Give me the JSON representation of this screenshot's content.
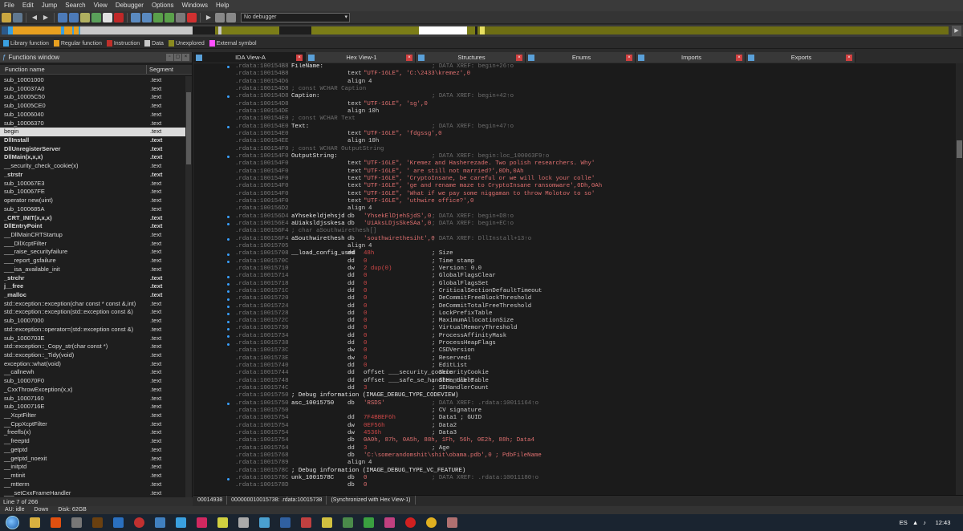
{
  "menubar": [
    "File",
    "Edit",
    "Jump",
    "Search",
    "View",
    "Debugger",
    "Options",
    "Windows",
    "Help"
  ],
  "toolbar": {
    "debugger_select": "No debugger"
  },
  "legend": [
    {
      "label": "Library function",
      "color": "#3aa0e0"
    },
    {
      "label": "Regular function",
      "color": "#e8a020"
    },
    {
      "label": "Instruction",
      "color": "#c0302a"
    },
    {
      "label": "Data",
      "color": "#c8c8c8"
    },
    {
      "label": "Unexplored",
      "color": "#8a8a20"
    },
    {
      "label": "External symbol",
      "color": "#ff50ff"
    }
  ],
  "functions_window": {
    "title": "Functions window",
    "col_name": "Function name",
    "col_segment": "Segment",
    "rows": [
      {
        "name": "sub_10001000",
        "seg": ".text"
      },
      {
        "name": "sub_100037A0",
        "seg": ".text"
      },
      {
        "name": "sub_10005C50",
        "seg": ".text"
      },
      {
        "name": "sub_10005CE0",
        "seg": ".text"
      },
      {
        "name": "sub_10006040",
        "seg": ".text"
      },
      {
        "name": "sub_10006370",
        "seg": ".text"
      },
      {
        "name": "begin",
        "seg": ".text"
      },
      {
        "name": "DllInstall",
        "seg": ".text"
      },
      {
        "name": "DllUnregisterServer",
        "seg": ".text"
      },
      {
        "name": "DllMain(x,x,x)",
        "seg": ".text"
      },
      {
        "name": "__security_check_cookie(x)",
        "seg": ".text"
      },
      {
        "name": "_strstr",
        "seg": ".text"
      },
      {
        "name": "sub_100067E3",
        "seg": ".text"
      },
      {
        "name": "sub_100067FE",
        "seg": ".text"
      },
      {
        "name": "operator new(uint)",
        "seg": ".text"
      },
      {
        "name": "sub_1000685A",
        "seg": ".text"
      },
      {
        "name": "_CRT_INIT(x,x,x)",
        "seg": ".text"
      },
      {
        "name": "DllEntryPoint",
        "seg": ".text"
      },
      {
        "name": "__DllMainCRTStartup",
        "seg": ".text"
      },
      {
        "name": "___DllXcptFilter",
        "seg": ".text"
      },
      {
        "name": "___raise_securityfailure",
        "seg": ".text"
      },
      {
        "name": "___report_gsfailure",
        "seg": ".text"
      },
      {
        "name": "___isa_available_init",
        "seg": ".text"
      },
      {
        "name": "_strchr",
        "seg": ".text"
      },
      {
        "name": "j__free",
        "seg": ".text"
      },
      {
        "name": "_malloc",
        "seg": ".text"
      },
      {
        "name": "std::exception::exception(char const * const &,int)",
        "seg": ".text"
      },
      {
        "name": "std::exception::exception(std::exception const &)",
        "seg": ".text"
      },
      {
        "name": "sub_10007000",
        "seg": ".text"
      },
      {
        "name": "std::exception::operator=(std::exception const &)",
        "seg": ".text"
      },
      {
        "name": "sub_1000703E",
        "seg": ".text"
      },
      {
        "name": "std::exception::_Copy_str(char const *)",
        "seg": ".text"
      },
      {
        "name": "std::exception::_Tidy(void)",
        "seg": ".text"
      },
      {
        "name": "exception::what(void)",
        "seg": ".text"
      },
      {
        "name": "__callnewh",
        "seg": ".text"
      },
      {
        "name": "sub_100070F0",
        "seg": ".text"
      },
      {
        "name": "_CxxThrowException(x,x)",
        "seg": ".text"
      },
      {
        "name": "sub_10007160",
        "seg": ".text"
      },
      {
        "name": "sub_1000716E",
        "seg": ".text"
      },
      {
        "name": "__XcptFilter",
        "seg": ".text"
      },
      {
        "name": "__CppXcptFilter",
        "seg": ".text"
      },
      {
        "name": "_freefls(x)",
        "seg": ".text"
      },
      {
        "name": "__freeptd",
        "seg": ".text"
      },
      {
        "name": "__getptd",
        "seg": ".text"
      },
      {
        "name": "__getptd_noexit",
        "seg": ".text"
      },
      {
        "name": "__initptd",
        "seg": ".text"
      },
      {
        "name": "__mtinit",
        "seg": ".text"
      },
      {
        "name": "__mtterm",
        "seg": ".text"
      },
      {
        "name": "___setCxxFrameHandler",
        "seg": ".text"
      }
    ],
    "bold_rows": [
      7,
      8,
      9,
      11,
      16,
      17,
      23,
      24,
      25
    ],
    "selected_row": 6,
    "status": "Line 7 of 266"
  },
  "tabs": [
    {
      "label": "IDA View-A",
      "active": true
    },
    {
      "label": "Hex View-1",
      "active": false
    },
    {
      "label": "Structures",
      "active": false
    },
    {
      "label": "Enums",
      "active": false
    },
    {
      "label": "Imports",
      "active": false
    },
    {
      "label": "Exports",
      "active": false
    }
  ],
  "code_lines": [
    {
      "a": ".rdata:100154B8",
      "l": "FileName:",
      "c": "",
      "x": "; DATA XREF: begin+26↑o"
    },
    {
      "a": ".rdata:100154B8",
      "l": "",
      "t": "text",
      "v": "\"UTF-16LE\", 'C:\\2433\\kremez',0",
      "x": ""
    },
    {
      "a": ".rdata:100154D6",
      "l": "",
      "t": "align",
      "v": "4",
      "x": ""
    },
    {
      "a": ".rdata:100154D8",
      "l": "",
      "t": "",
      "v": "; const WCHAR Caption",
      "x": "",
      "cm": true
    },
    {
      "a": ".rdata:100154D8",
      "l": "Caption:",
      "c": "",
      "x": "; DATA XREF: begin+42↑o"
    },
    {
      "a": ".rdata:100154D8",
      "l": "",
      "t": "text",
      "v": "\"UTF-16LE\", 'sg',0",
      "x": ""
    },
    {
      "a": ".rdata:100154DE",
      "l": "",
      "t": "align",
      "v": "10h",
      "x": ""
    },
    {
      "a": ".rdata:100154E0",
      "l": "",
      "t": "",
      "v": "; const WCHAR Text",
      "x": "",
      "cm": true
    },
    {
      "a": ".rdata:100154E0",
      "l": "Text:",
      "c": "",
      "x": "; DATA XREF: begin+47↑o"
    },
    {
      "a": ".rdata:100154E0",
      "l": "",
      "t": "text",
      "v": "\"UTF-16LE\", 'fdgssg',0",
      "x": ""
    },
    {
      "a": ".rdata:100154EE",
      "l": "",
      "t": "align",
      "v": "10h",
      "x": ""
    },
    {
      "a": ".rdata:100154F0",
      "l": "",
      "t": "",
      "v": "; const WCHAR OutputString",
      "x": "",
      "cm": true
    },
    {
      "a": ".rdata:100154F0",
      "l": "OutputString:",
      "c": "",
      "x": "; DATA XREF: begin:loc_100063F9↑o"
    },
    {
      "a": ".rdata:100154F0",
      "l": "",
      "t": "text",
      "v": "\"UTF-16LE\", 'Kremez and Hasherezade. Two polish researchers. Why'",
      "x": ""
    },
    {
      "a": ".rdata:100154F0",
      "l": "",
      "t": "text",
      "v": "\"UTF-16LE\", ' are still not married?',0Dh,0Ah",
      "x": ""
    },
    {
      "a": ".rdata:100154F0",
      "l": "",
      "t": "text",
      "v": "\"UTF-16LE\", 'CryptoInsane, be careful or we will lock your colle'",
      "x": ""
    },
    {
      "a": ".rdata:100154F0",
      "l": "",
      "t": "text",
      "v": "\"UTF-16LE\", 'ge and rename maze to CryptoInsane ransomware',0Dh,0Ah",
      "x": ""
    },
    {
      "a": ".rdata:100154F0",
      "l": "",
      "t": "text",
      "v": "\"UTF-16LE\", 'What if we pay some niggaman to throw Molotov to so'",
      "x": ""
    },
    {
      "a": ".rdata:100154F0",
      "l": "",
      "t": "text",
      "v": "\"UTF-16LE\", 'uthwire office?',0",
      "x": ""
    },
    {
      "a": ".rdata:100156D2",
      "l": "",
      "t": "align",
      "v": "4",
      "x": ""
    },
    {
      "a": ".rdata:100156D4",
      "l": "aYhsekeldjehsjd",
      "t": "db",
      "v": "'YhsekElDjehSjdS',0",
      "x": "; DATA XREF: begin+D8↑o"
    },
    {
      "a": ".rdata:100156E4",
      "l": "aUiaksldjsskesa",
      "t": "db",
      "v": "'UiAksLDjsSkeSAa',0",
      "x": "; DATA XREF: begin+EC↑o"
    },
    {
      "a": ".rdata:100156F4",
      "l": "",
      "t": "",
      "v": "; char aSouthwirethesh[]",
      "x": "",
      "cm": true
    },
    {
      "a": ".rdata:100156F4",
      "l": "aSouthwirethesh",
      "t": "db",
      "v": "'southwirethesiht',0",
      "x": "; DATA XREF: DllInstall+13↑o"
    },
    {
      "a": ".rdata:10015705",
      "l": "",
      "t": "align",
      "v": "4",
      "x": ""
    },
    {
      "a": ".rdata:10015708",
      "l": "__load_config_used",
      "t": "dd",
      "v": "48h",
      "x": "; Size"
    },
    {
      "a": ".rdata:1001570C",
      "l": "",
      "t": "dd",
      "v": "0",
      "x": "; Time stamp"
    },
    {
      "a": ".rdata:10015710",
      "l": "",
      "t": "dw",
      "v": "2 dup(0)",
      "x": "; Version: 0.0"
    },
    {
      "a": ".rdata:10015714",
      "l": "",
      "t": "dd",
      "v": "0",
      "x": "; GlobalFlagsClear"
    },
    {
      "a": ".rdata:10015718",
      "l": "",
      "t": "dd",
      "v": "0",
      "x": "; GlobalFlagsSet"
    },
    {
      "a": ".rdata:1001571C",
      "l": "",
      "t": "dd",
      "v": "0",
      "x": "; CriticalSectionDefaultTimeout"
    },
    {
      "a": ".rdata:10015720",
      "l": "",
      "t": "dd",
      "v": "0",
      "x": "; DeCommitFreeBlockThreshold"
    },
    {
      "a": ".rdata:10015724",
      "l": "",
      "t": "dd",
      "v": "0",
      "x": "; DeCommitTotalFreeThreshold"
    },
    {
      "a": ".rdata:10015728",
      "l": "",
      "t": "dd",
      "v": "0",
      "x": "; LockPrefixTable"
    },
    {
      "a": ".rdata:1001572C",
      "l": "",
      "t": "dd",
      "v": "0",
      "x": "; MaximumAllocationSize"
    },
    {
      "a": ".rdata:10015730",
      "l": "",
      "t": "dd",
      "v": "0",
      "x": "; VirtualMemoryThreshold"
    },
    {
      "a": ".rdata:10015734",
      "l": "",
      "t": "dd",
      "v": "0",
      "x": "; ProcessAffinityMask"
    },
    {
      "a": ".rdata:10015738",
      "l": "",
      "t": "dd",
      "v": "0",
      "x": "; ProcessHeapFlags"
    },
    {
      "a": ".rdata:1001573C",
      "l": "",
      "t": "dw",
      "v": "0",
      "x": "; CSDVersion"
    },
    {
      "a": ".rdata:1001573E",
      "l": "",
      "t": "dw",
      "v": "0",
      "x": "; Reserved1"
    },
    {
      "a": ".rdata:10015740",
      "l": "",
      "t": "dd",
      "v": "0",
      "x": "; EditList"
    },
    {
      "a": ".rdata:10015744",
      "l": "",
      "t": "dd",
      "v": "offset ___security_cookie",
      "x": "; SecurityCookie"
    },
    {
      "a": ".rdata:10015748",
      "l": "",
      "t": "dd",
      "v": "offset ___safe_se_handler_table",
      "x": "; SEHandlerTable"
    },
    {
      "a": ".rdata:1001574C",
      "l": "",
      "t": "dd",
      "v": "3",
      "x": "; SEHandlerCount"
    },
    {
      "a": ".rdata:10015750",
      "l": "",
      "t": "",
      "v": "; Debug information (IMAGE_DEBUG_TYPE_CODEVIEW)",
      "x": "",
      "cm2": true
    },
    {
      "a": ".rdata:10015750",
      "l": "asc_10015750",
      "t": "db",
      "v": "'RSDS'",
      "x": "; DATA XREF: .rdata:10011164↑o"
    },
    {
      "a": ".rdata:10015750",
      "l": "",
      "t": "",
      "v": "",
      "x": "; CV signature"
    },
    {
      "a": ".rdata:10015754",
      "l": "",
      "t": "dd",
      "v": "7F4BBEF6h",
      "x": "; Data1 ; GUID"
    },
    {
      "a": ".rdata:10015754",
      "l": "",
      "t": "dw",
      "v": "0EF56h",
      "x": "; Data2"
    },
    {
      "a": ".rdata:10015754",
      "l": "",
      "t": "dw",
      "v": "4536h",
      "x": "; Data3"
    },
    {
      "a": ".rdata:10015754",
      "l": "",
      "t": "db",
      "v": "0A0h, 87h, 0A5h, 88h, 1Fh, 56h, 0E2h, 88h; Data4",
      "x": ""
    },
    {
      "a": ".rdata:10015764",
      "l": "",
      "t": "dd",
      "v": "3",
      "x": "; Age"
    },
    {
      "a": ".rdata:10015768",
      "l": "",
      "t": "db",
      "v": "'C:\\somerandomshit\\shit\\obama.pdb',0 ; PdbFileName",
      "x": ""
    },
    {
      "a": ".rdata:10015789",
      "l": "",
      "t": "align",
      "v": "4",
      "x": ""
    },
    {
      "a": ".rdata:1001578C",
      "l": "",
      "t": "",
      "v": "; Debug information (IMAGE_DEBUG_TYPE_VC_FEATURE)",
      "x": "",
      "cm2": true
    },
    {
      "a": ".rdata:1001578C",
      "l": "unk_1001578C",
      "t": "db",
      "v": "0",
      "x": "; DATA XREF: .rdata:10011180↑o"
    },
    {
      "a": ".rdata:1001578D",
      "l": "",
      "t": "db",
      "v": "0",
      "x": ""
    }
  ],
  "code_status": [
    "00014938",
    "000000010015738: .rdata:10015738",
    "(Synchronized with Hex View-1)"
  ],
  "bottom_status": [
    "AU: idle",
    "Down",
    "Disk: 62GB"
  ],
  "taskbar": {
    "clock": "12:43",
    "lang": "ES"
  }
}
